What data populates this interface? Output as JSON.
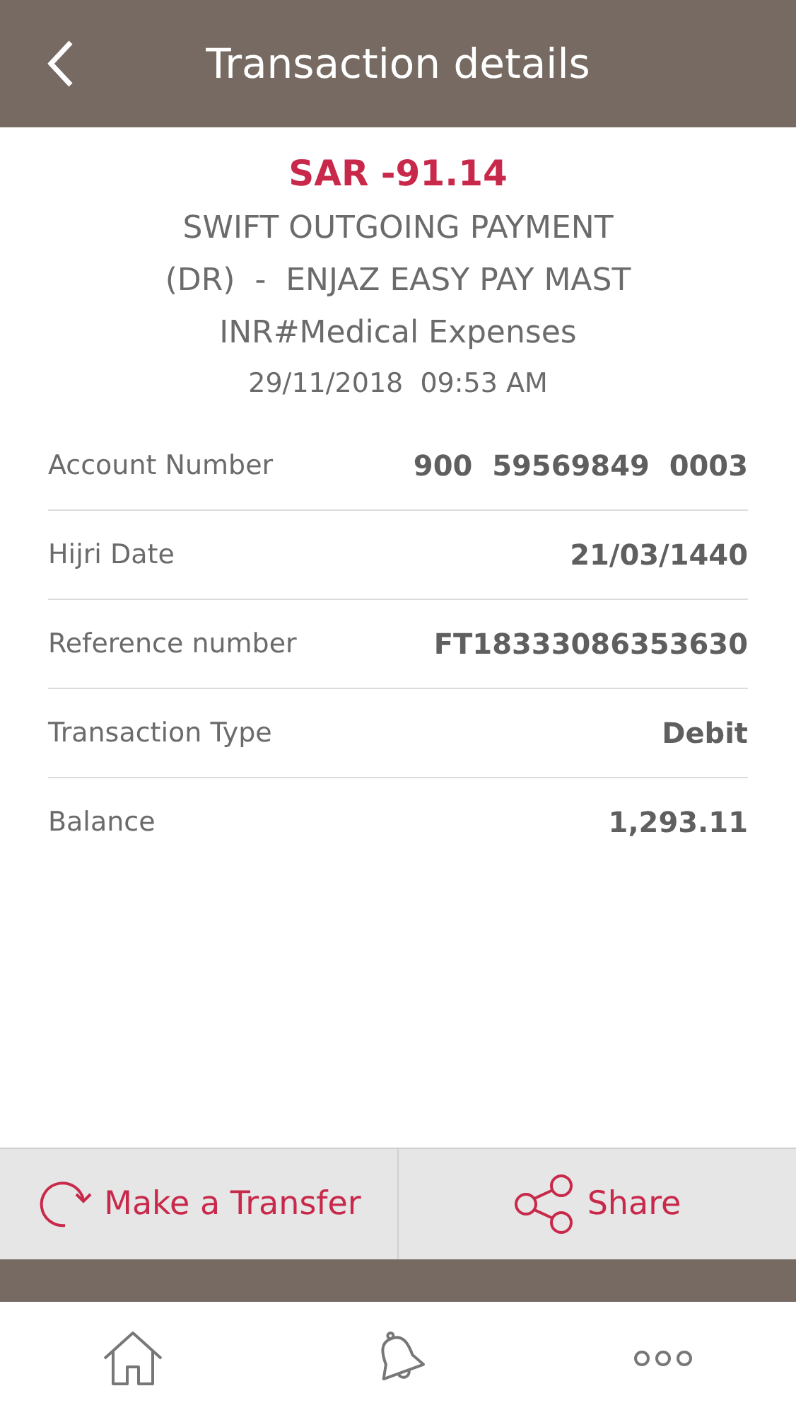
{
  "header": {
    "title": "Transaction details"
  },
  "summary": {
    "amount": "SAR -91.14",
    "description_lines": [
      "SWIFT OUTGOING PAYMENT",
      "(DR)  -  ENJAZ EASY PAY MAST",
      "INR#Medical Expenses"
    ],
    "datetime": "29/11/2018  09:53 AM"
  },
  "details": [
    {
      "label": "Account Number",
      "value": "900  59569849  0003"
    },
    {
      "label": "Hijri Date",
      "value": "21/03/1440"
    },
    {
      "label": "Reference number",
      "value": "FT18333086353630"
    },
    {
      "label": "Transaction Type",
      "value": "Debit"
    },
    {
      "label": "Balance",
      "value": "1,293.11"
    }
  ],
  "actions": [
    {
      "kind": "transfer",
      "label": "Make a Transfer"
    },
    {
      "kind": "share",
      "label": "Share"
    }
  ],
  "nav": [
    {
      "kind": "home"
    },
    {
      "kind": "bell"
    },
    {
      "kind": "more"
    }
  ]
}
